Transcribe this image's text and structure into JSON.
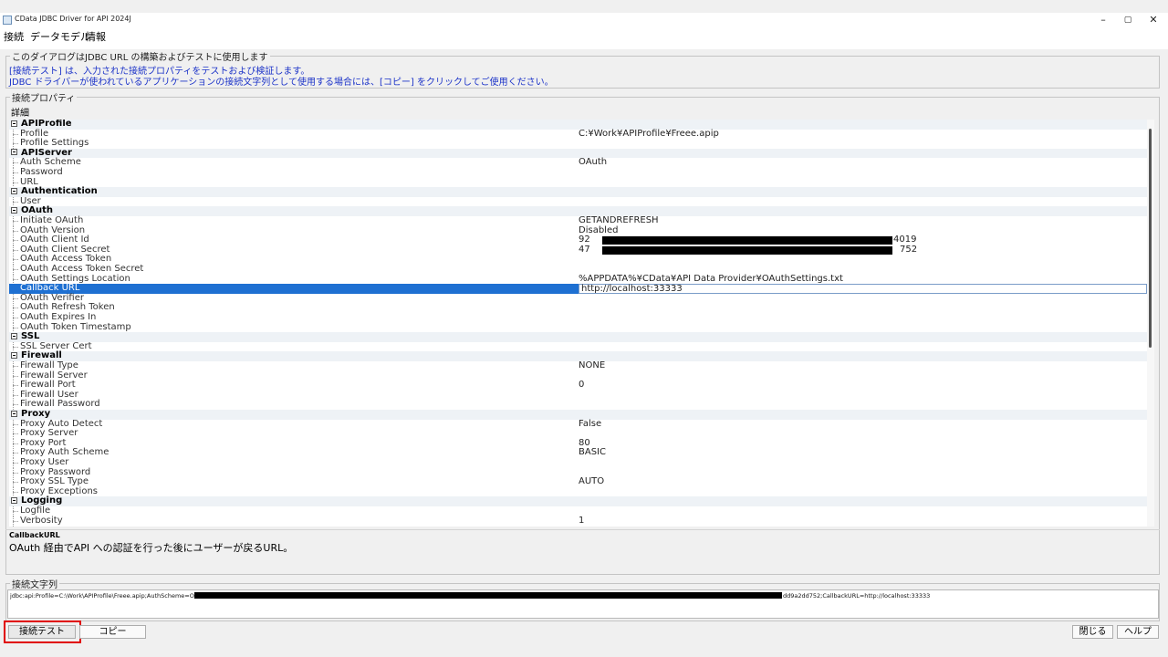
{
  "window": {
    "title": "CData JDBC Driver for API 2024J",
    "controls": {
      "minimize": "–",
      "maximize": "▢",
      "close": "✕"
    }
  },
  "menu": [
    "接続",
    "データモデル",
    "情報"
  ],
  "info": {
    "legend": "このダイアログはJDBC URL の構築およびテストに使用します",
    "line1": "[接続テスト] は、入力された接続プロパティをテストおよび検証します。",
    "line2": "JDBC ドライバーが使われているアプリケーションの接続文字列として使用する場合には、[コピー] をクリックしてご使用ください。"
  },
  "props": {
    "legend": "接続プロパティ",
    "detail_label": "詳細",
    "rows": [
      {
        "type": "cat",
        "label": "APIProfile"
      },
      {
        "type": "prop",
        "label": "Profile",
        "value": "C:¥Work¥APIProfile¥Freee.apip"
      },
      {
        "type": "prop",
        "label": "Profile Settings",
        "value": ""
      },
      {
        "type": "cat",
        "label": "APIServer"
      },
      {
        "type": "prop",
        "label": "Auth Scheme",
        "value": "OAuth"
      },
      {
        "type": "prop",
        "label": "Password",
        "value": ""
      },
      {
        "type": "prop",
        "label": "URL",
        "value": ""
      },
      {
        "type": "cat",
        "label": "Authentication"
      },
      {
        "type": "prop",
        "label": "User",
        "value": ""
      },
      {
        "type": "cat",
        "label": "OAuth"
      },
      {
        "type": "prop",
        "label": "Initiate OAuth",
        "value": "GETANDREFRESH"
      },
      {
        "type": "prop",
        "label": "OAuth Version",
        "value": "Disabled"
      },
      {
        "type": "prop",
        "label": "OAuth Client Id",
        "value": "92",
        "value_tail": "4019"
      },
      {
        "type": "prop",
        "label": "OAuth Client Secret",
        "value": "47",
        "value_tail": "752"
      },
      {
        "type": "prop",
        "label": "OAuth Access Token",
        "value": ""
      },
      {
        "type": "prop",
        "label": "OAuth Access Token Secret",
        "value": ""
      },
      {
        "type": "prop",
        "label": "OAuth Settings Location",
        "value": "%APPDATA%¥CData¥API Data Provider¥OAuthSettings.txt"
      },
      {
        "type": "prop",
        "label": "Callback URL",
        "value": "http://localhost:33333",
        "selected": true
      },
      {
        "type": "prop",
        "label": "OAuth Verifier",
        "value": ""
      },
      {
        "type": "prop",
        "label": "OAuth Refresh Token",
        "value": ""
      },
      {
        "type": "prop",
        "label": "OAuth Expires In",
        "value": ""
      },
      {
        "type": "prop",
        "label": "OAuth Token Timestamp",
        "value": ""
      },
      {
        "type": "cat",
        "label": "SSL"
      },
      {
        "type": "prop",
        "label": "SSL Server Cert",
        "value": ""
      },
      {
        "type": "cat",
        "label": "Firewall"
      },
      {
        "type": "prop",
        "label": "Firewall Type",
        "value": "NONE"
      },
      {
        "type": "prop",
        "label": "Firewall Server",
        "value": ""
      },
      {
        "type": "prop",
        "label": "Firewall Port",
        "value": "0"
      },
      {
        "type": "prop",
        "label": "Firewall User",
        "value": ""
      },
      {
        "type": "prop",
        "label": "Firewall Password",
        "value": ""
      },
      {
        "type": "cat",
        "label": "Proxy"
      },
      {
        "type": "prop",
        "label": "Proxy Auto Detect",
        "value": "False"
      },
      {
        "type": "prop",
        "label": "Proxy Server",
        "value": ""
      },
      {
        "type": "prop",
        "label": "Proxy Port",
        "value": "80"
      },
      {
        "type": "prop",
        "label": "Proxy Auth Scheme",
        "value": "BASIC"
      },
      {
        "type": "prop",
        "label": "Proxy User",
        "value": ""
      },
      {
        "type": "prop",
        "label": "Proxy Password",
        "value": ""
      },
      {
        "type": "prop",
        "label": "Proxy SSL Type",
        "value": "AUTO"
      },
      {
        "type": "prop",
        "label": "Proxy Exceptions",
        "value": ""
      },
      {
        "type": "cat",
        "label": "Logging"
      },
      {
        "type": "prop",
        "label": "Logfile",
        "value": ""
      },
      {
        "type": "prop",
        "label": "Verbosity",
        "value": "1"
      }
    ]
  },
  "description": {
    "title": "CallbackURL",
    "text": "OAuth 経由でAPI への認証を行った後にユーザーが戻るURL。"
  },
  "connection": {
    "legend": "接続文字列",
    "text_head": "jdbc:api:Profile=C:\\Work\\APIProfile\\Freee.apip;AuthScheme=OAuth;",
    "text_tail": "dd9a2dd752;CallbackURL=http://localhost:33333"
  },
  "buttons": {
    "test": "接続テスト",
    "copy": "コピー",
    "close": "閉じる",
    "help": "ヘルプ"
  }
}
